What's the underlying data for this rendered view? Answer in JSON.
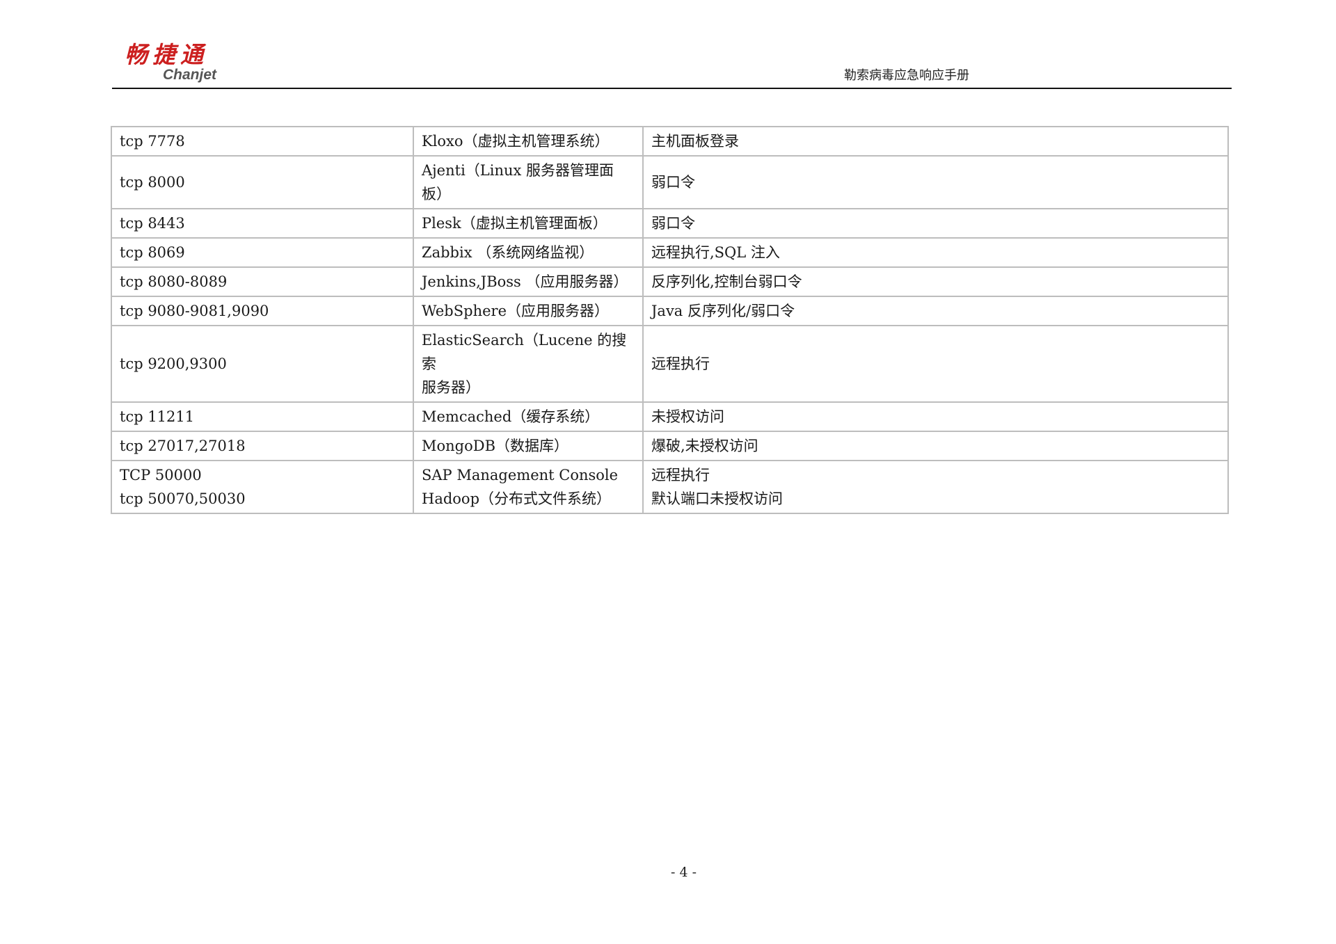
{
  "header": {
    "logo_cn": "畅捷通",
    "logo_en": "Chanjet",
    "doc_title": "勒索病毒应急响应手册"
  },
  "table": {
    "rows": [
      {
        "port": [
          "tcp 7778"
        ],
        "service": [
          "Kloxo（虚拟主机管理系统）"
        ],
        "risk": [
          "主机面板登录"
        ]
      },
      {
        "port": [
          "tcp 8000"
        ],
        "service": [
          "Ajenti（Linux 服务器管理面",
          "板）"
        ],
        "risk": [
          "弱口令"
        ]
      },
      {
        "port": [
          "tcp 8443"
        ],
        "service": [
          "Plesk（虚拟主机管理面板）"
        ],
        "risk": [
          "弱口令"
        ]
      },
      {
        "port": [
          "tcp 8069"
        ],
        "service": [
          "Zabbix （系统网络监视）"
        ],
        "risk": [
          "远程执行,SQL 注入"
        ]
      },
      {
        "port": [
          "tcp 8080-8089"
        ],
        "service": [
          "Jenkins,JBoss （应用服务器）"
        ],
        "risk": [
          "反序列化,控制台弱口令"
        ]
      },
      {
        "port": [
          "tcp 9080-9081,9090"
        ],
        "service": [
          "WebSphere（应用服务器）"
        ],
        "risk": [
          "Java 反序列化/弱口令"
        ]
      },
      {
        "port": [
          "tcp 9200,9300"
        ],
        "service": [
          "ElasticSearch（Lucene 的搜索",
          "服务器）"
        ],
        "risk": [
          "远程执行"
        ]
      },
      {
        "port": [
          "tcp 11211"
        ],
        "service": [
          "Memcached（缓存系统）"
        ],
        "risk": [
          "未授权访问"
        ]
      },
      {
        "port": [
          "tcp 27017,27018"
        ],
        "service": [
          "MongoDB（数据库）"
        ],
        "risk": [
          "爆破,未授权访问"
        ]
      },
      {
        "port": [
          "TCP 50000",
          "tcp 50070,50030"
        ],
        "service": [
          "SAP Management Console",
          "Hadoop（分布式文件系统）"
        ],
        "risk": [
          "远程执行",
          "默认端口未授权访问"
        ]
      }
    ]
  },
  "footer": {
    "page_number": "- 4 -"
  }
}
